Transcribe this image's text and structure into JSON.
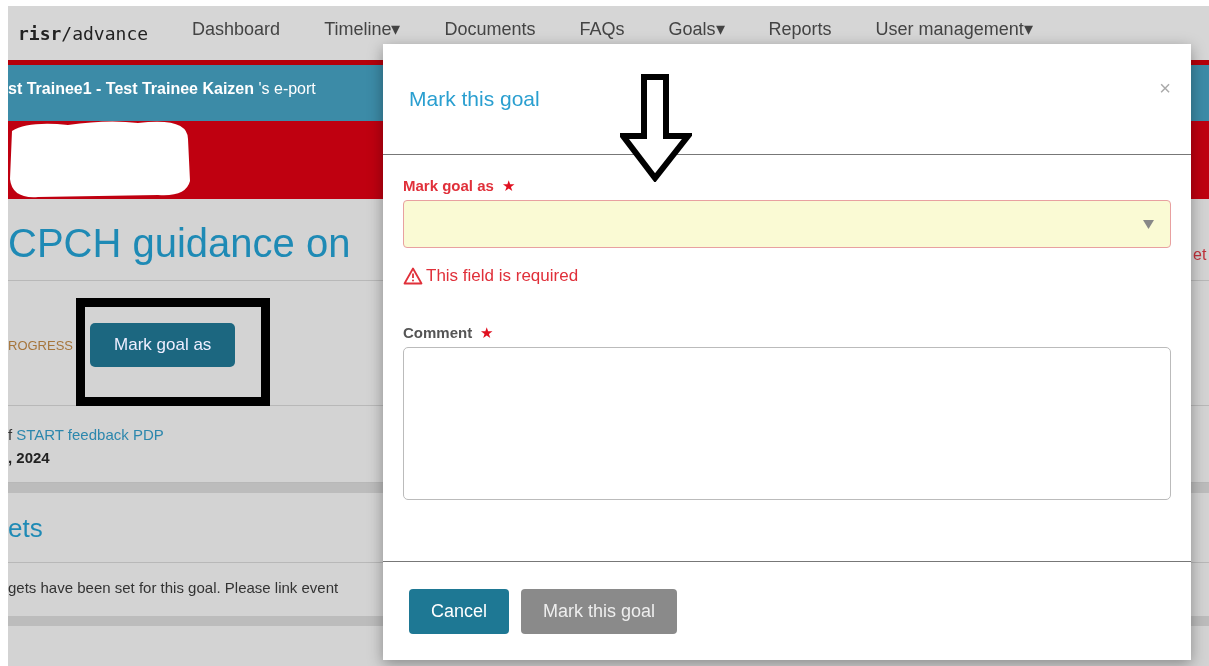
{
  "navbar": {
    "logo": "**risr**/advance",
    "items": [
      {
        "label": "Dashboard",
        "dropdown": false
      },
      {
        "label": "Timeline",
        "dropdown": true
      },
      {
        "label": "Documents",
        "dropdown": false
      },
      {
        "label": "FAQs",
        "dropdown": false
      },
      {
        "label": "Goals",
        "dropdown": true
      },
      {
        "label": "Reports",
        "dropdown": false
      },
      {
        "label": "User management",
        "dropdown": true
      }
    ],
    "caret": "▾"
  },
  "banner": {
    "text": "**st Trainee1 - Test Trainee Kaizen** 's e-port"
  },
  "goal": {
    "title": "CPCH guidance on",
    "status": "ROGRESS",
    "action": "Mark goal as",
    "linked_prefix": "f",
    "linked": "START feedback PDP",
    "date": ", 2024",
    "side_text": "et"
  },
  "targets": {
    "heading": "ets",
    "message": "gets have been set for this goal. Please link event"
  },
  "modal": {
    "title": "Mark this goal",
    "close": "×",
    "fields": [
      {
        "kind": "select",
        "label": "Mark goal as",
        "star": "★",
        "invalid": true,
        "error": "This field is required"
      },
      {
        "kind": "textarea",
        "label": "Comment",
        "star": "★",
        "invalid": false
      }
    ],
    "buttons": [
      {
        "label": "Cancel",
        "disabled": false
      },
      {
        "label": "Mark this goal",
        "disabled": true
      }
    ]
  }
}
